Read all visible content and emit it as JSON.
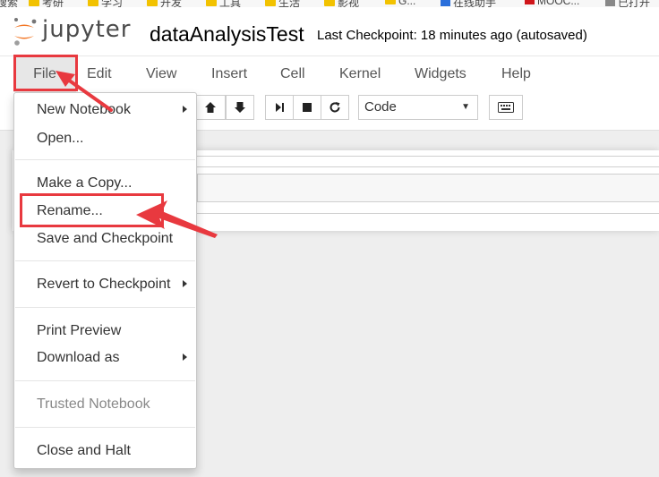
{
  "bookmarks": [
    {
      "label": "搜索",
      "kind": "folder"
    },
    {
      "label": "考研",
      "kind": "folder"
    },
    {
      "label": "学习",
      "kind": "folder"
    },
    {
      "label": "开发",
      "kind": "folder"
    },
    {
      "label": "工具",
      "kind": "folder"
    },
    {
      "label": "生活",
      "kind": "folder"
    },
    {
      "label": "影视",
      "kind": "folder"
    },
    {
      "label": "G...",
      "kind": "folder"
    },
    {
      "label": "在线助手",
      "kind": "fav"
    },
    {
      "label": "MOOC...",
      "kind": "fav-red"
    },
    {
      "label": "已打开",
      "kind": "fav"
    }
  ],
  "header": {
    "logo_text": "jupyter",
    "notebook_name": "dataAnalysisTest",
    "checkpoint": "Last Checkpoint: 18 minutes ago (autosaved)"
  },
  "menubar": {
    "items": [
      "File",
      "Edit",
      "View",
      "Insert",
      "Cell",
      "Kernel",
      "Widgets",
      "Help"
    ]
  },
  "toolbar": {
    "cell_type": "Code",
    "buttons": [
      "arrow-up-icon",
      "arrow-down-icon",
      "run-next-icon",
      "stop-icon",
      "restart-icon",
      "keyboard-icon"
    ]
  },
  "file_menu": {
    "items": [
      {
        "label": "New Notebook",
        "submenu": true
      },
      {
        "label": "Open..."
      },
      {
        "label": "Make a Copy..."
      },
      {
        "label": "Rename..."
      },
      {
        "label": "Save and Checkpoint"
      },
      {
        "label": "Revert to Checkpoint",
        "submenu": true
      },
      {
        "label": "Print Preview"
      },
      {
        "label": "Download as",
        "submenu": true
      },
      {
        "label": "Trusted Notebook",
        "disabled": true
      },
      {
        "label": "Close and Halt"
      }
    ]
  },
  "colors": {
    "highlight": "#e8393f",
    "logo_orange": "#f37726"
  }
}
